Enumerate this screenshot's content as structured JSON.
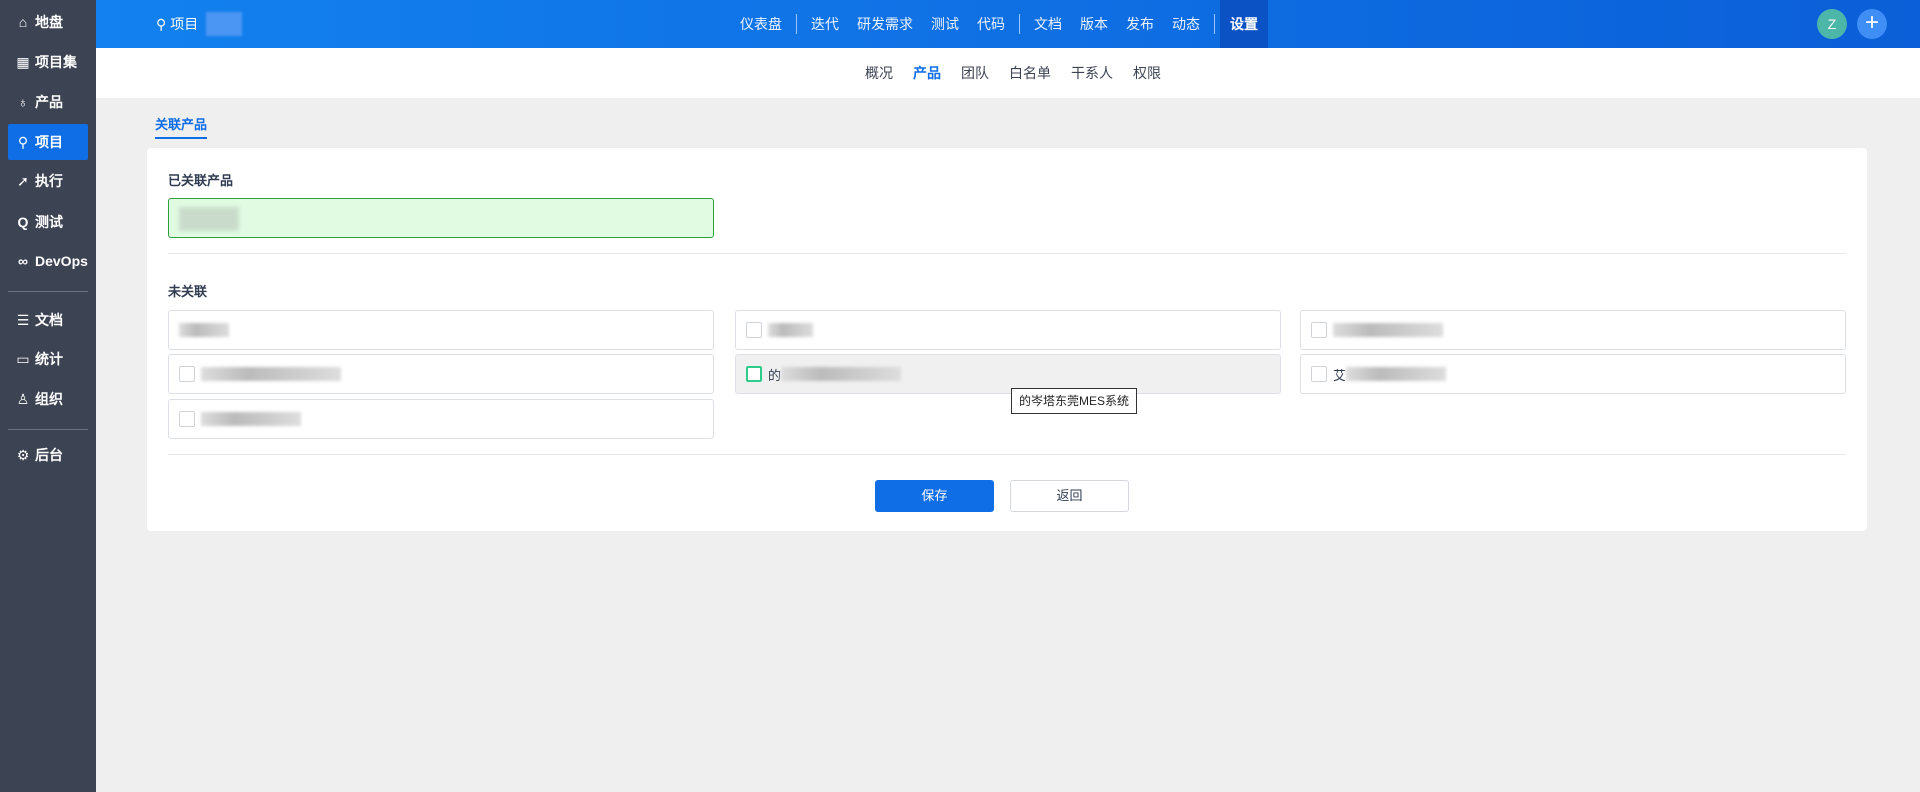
{
  "sidebar": {
    "items": [
      {
        "label": "地盘",
        "icon": "⌂"
      },
      {
        "label": "项目集",
        "icon": "▦"
      },
      {
        "label": "产品",
        "icon": "♁"
      },
      {
        "label": "项目",
        "icon": "⚲"
      },
      {
        "label": "执行",
        "icon": "➚"
      },
      {
        "label": "测试",
        "icon": "Q"
      },
      {
        "label": "DevOps",
        "icon": "∞"
      },
      {
        "label": "文档",
        "icon": "☰"
      },
      {
        "label": "统计",
        "icon": "▭"
      },
      {
        "label": "组织",
        "icon": "♙"
      },
      {
        "label": "后台",
        "icon": "⚙"
      }
    ]
  },
  "topbar": {
    "project_label": "项目",
    "nav": [
      "仪表盘",
      "迭代",
      "研发需求",
      "测试",
      "代码",
      "文档",
      "版本",
      "发布",
      "动态",
      "设置"
    ],
    "active": "设置",
    "avatar": "Z",
    "add": "+"
  },
  "subnav": {
    "items": [
      "概况",
      "产品",
      "团队",
      "白名单",
      "干系人",
      "权限"
    ],
    "active": "产品"
  },
  "tab": "关联产品",
  "card": {
    "linked_title": "已关联产品",
    "unlinked_title": "未关联",
    "options": [
      {
        "text": ""
      },
      {
        "text": ""
      },
      {
        "text": ""
      },
      {
        "text": ""
      },
      {
        "text": "的"
      },
      {
        "text": "艾"
      },
      {
        "text": ""
      }
    ],
    "tooltip": "的岑塔东莞MES系统",
    "save": "保存",
    "back": "返回"
  },
  "colors": {
    "primary": "#0f6ee6",
    "sidebar": "#3c4353"
  }
}
